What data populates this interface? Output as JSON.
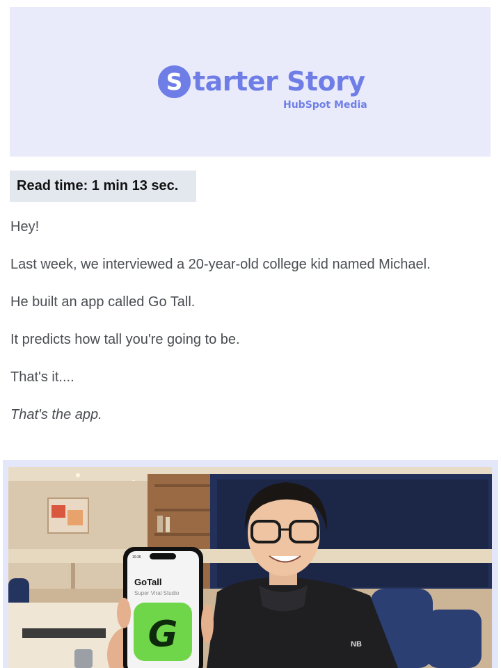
{
  "header": {
    "logo_letter": "S",
    "logo_word": "tarter Story",
    "logo_sub": "HubSpot Media"
  },
  "read_time": "Read time: 1 min 13 sec.",
  "paragraphs": [
    "Hey!",
    "Last week, we interviewed a 20-year-old college kid named Michael.",
    "He built an app called Go Tall.",
    "It predicts how tall you're going to be.",
    "That's it....",
    "That's the app."
  ],
  "photo": {
    "phone_time": "10:36",
    "app_name": "GoTall",
    "app_subtitle": "Super Viral Studio",
    "app_icon_letter": "G",
    "jacket_badge": "NB"
  },
  "colors": {
    "brand": "#6f7ee6",
    "banner_bg": "#e9ebfa",
    "readtime_bg": "#e3e8ef",
    "text": "#4a4d52",
    "app_green": "#6fd64a"
  }
}
